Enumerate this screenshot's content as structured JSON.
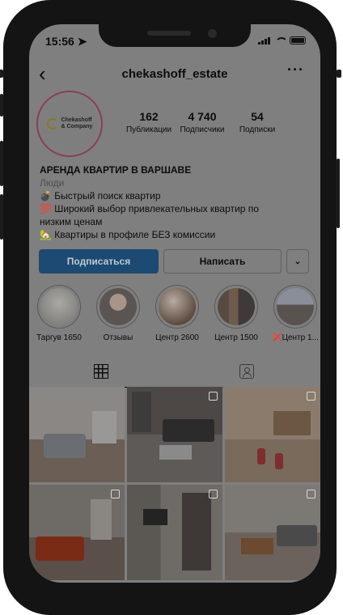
{
  "status": {
    "time": "15:56"
  },
  "profile": {
    "username": "chekashoff_estate",
    "logo_text": [
      "Chekashoff",
      "& Company"
    ],
    "stats": [
      {
        "num": "162",
        "label": "Публикации"
      },
      {
        "num": "4 740",
        "label": "Подписчики"
      },
      {
        "num": "54",
        "label": "Подписки"
      }
    ],
    "bio": {
      "title": "АРЕНДА КВАРТИР В ВАРШАВЕ",
      "category": "Люди",
      "lines": [
        "💣 Быстрый поиск квартир",
        "💯 Широкий выбор привлекательных квартир по низким ценам",
        "🏡 Квартиры в профиле БЕЗ комиссии"
      ]
    },
    "buttons": {
      "follow": "Подписаться",
      "message": "Написать",
      "dropdown": "⌄"
    }
  },
  "highlights": [
    {
      "label": "Таргув 1650",
      "mark": ""
    },
    {
      "label": "Отзывы",
      "mark": ""
    },
    {
      "label": "Центр 2600",
      "mark": ""
    },
    {
      "label": "Центр 1500",
      "mark": ""
    },
    {
      "label": "Центр 1...",
      "mark": "❌"
    }
  ],
  "icons": {
    "back": "chevron-left-icon",
    "more": "more-horizontal-icon",
    "grid": "grid-icon",
    "tagged": "tagged-icon"
  },
  "colors": {
    "follow_button": "#1c4a72",
    "overlay": "#7f7f7f"
  }
}
